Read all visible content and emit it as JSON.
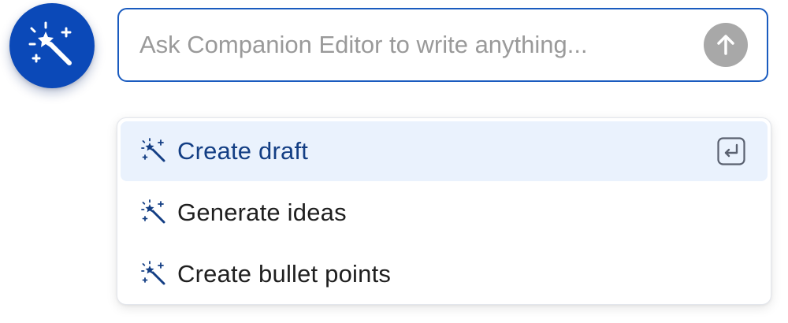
{
  "fab": {
    "icon": "magic-wand-icon"
  },
  "prompt": {
    "placeholder": "Ask Companion Editor to write anything...",
    "value": "",
    "send_icon": "arrow-up-icon"
  },
  "suggestions": {
    "items": [
      {
        "label": "Create draft",
        "icon": "magic-wand-icon",
        "active": true,
        "shortcut_icon": "enter-key-icon"
      },
      {
        "label": "Generate ideas",
        "icon": "magic-wand-icon",
        "active": false
      },
      {
        "label": "Create bullet points",
        "icon": "magic-wand-icon",
        "active": false
      }
    ]
  },
  "colors": {
    "accent": "#0b49b8",
    "border": "#1a5bbf",
    "active_bg": "#eaf2fd",
    "active_text": "#133e84",
    "send_disabled": "#a8a8a8",
    "placeholder": "#9a9a9a"
  }
}
